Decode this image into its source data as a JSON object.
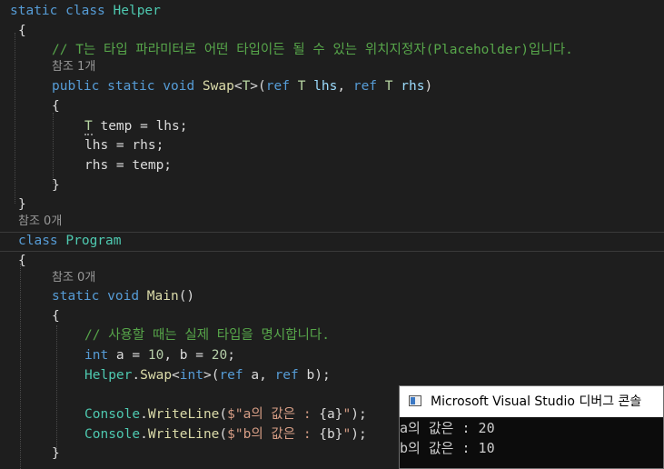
{
  "code": {
    "helper_class": {
      "kw_static": "static",
      "kw_class": "class",
      "name": "Helper",
      "open_brace": "{",
      "comment": "// T는 타입 파라미터로 어떤 타입이든 될 수 있는 위치지정자(Placeholder)입니다.",
      "swap_refs": "참조 1개",
      "swap_sig": {
        "kw_public": "public",
        "kw_static": "static",
        "kw_void": "void",
        "name": "Swap",
        "lt": "<",
        "tparam": "T",
        "gt_paren": ">(",
        "kw_ref1": "ref",
        "type1": "T",
        "param1": "lhs",
        "comma": ", ",
        "kw_ref2": "ref",
        "type2": "T",
        "param2": "rhs",
        "close": ")"
      },
      "swap_open": "{",
      "body_line1": {
        "type": "T",
        "rest": " temp = lhs;"
      },
      "body_line2": "lhs = rhs;",
      "body_line3": "rhs = temp;",
      "swap_close": "}",
      "close_brace": "}"
    },
    "program_refs": "참조 0개",
    "program_class": {
      "kw_class": "class",
      "name": "Program",
      "open_brace": "{",
      "main_refs": "참조 0개",
      "main_sig": {
        "kw_static": "static",
        "kw_void": "void",
        "name": "Main",
        "parens": "()"
      },
      "main_open": "{",
      "comment": "// 사용할 때는 실제 타입을 명시합니다.",
      "decl": {
        "kw_int": "int",
        "a": " a = ",
        "ten": "10",
        "b": ", b = ",
        "twenty": "20",
        "semi": ";"
      },
      "call": {
        "cls": "Helper",
        "dot": ".",
        "method": "Swap",
        "lt": "<",
        "kw_int": "int",
        "gt_paren": ">(",
        "kw_ref1": "ref",
        "a": " a, ",
        "kw_ref2": "ref",
        "b": " b);"
      },
      "writeline1": {
        "cls": "Console",
        "dot": ".",
        "method": "WriteLine",
        "open": "(",
        "str_pre": "$\"a의 값은 : ",
        "interp": "{a}",
        "str_post": "\"",
        "close": ");"
      },
      "writeline2": {
        "cls": "Console",
        "dot": ".",
        "method": "WriteLine",
        "open": "(",
        "str_pre": "$\"b의 값은 : ",
        "interp": "{b}",
        "str_post": "\"",
        "close": ");"
      },
      "main_close": "}"
    }
  },
  "debug_console": {
    "title": "Microsoft Visual Studio 디버그 콘솔",
    "icon": "console-window-icon",
    "output": [
      "a의 값은 : 20",
      "b의 값은 : 10"
    ]
  },
  "colors": {
    "editor_background": "#1e1e1e",
    "keyword": "#569cd6",
    "type": "#4ec9b0",
    "method": "#dcdcaa",
    "comment": "#57a64a",
    "string": "#d69d85",
    "number": "#b5cea8",
    "console_background": "#0c0c0c"
  }
}
